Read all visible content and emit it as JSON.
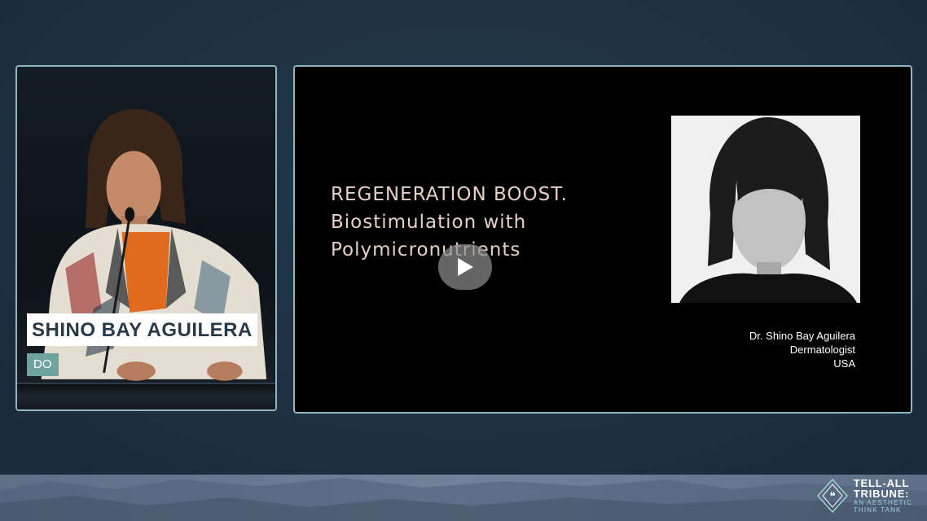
{
  "speaker_panel": {
    "name": "SHINO BAY AGUILERA",
    "credential": "DO"
  },
  "slide": {
    "title_lines": [
      "REGENERATION BOOST.",
      "Biostimulation with",
      "Polymicronutrients"
    ],
    "caption_lines": [
      "Dr. Shino Bay Aguilera",
      "Dermatologist",
      "USA"
    ]
  },
  "banner": {
    "logo_lines": [
      "TELL-ALL",
      "TRIBUNE:",
      "AN AESTHETIC",
      "THINK TANK"
    ]
  },
  "icons": {
    "play": "play-icon",
    "logo": "tribune-quote-diamond-icon"
  },
  "colors": {
    "panel_border": "#8fb7bd",
    "nameplate_bg": "#ffffff",
    "nameplate_text": "#283948",
    "credential_bg": "#6fa39e",
    "slide_title": "#e8cfc4",
    "logo_accent": "#9fd2d6"
  }
}
